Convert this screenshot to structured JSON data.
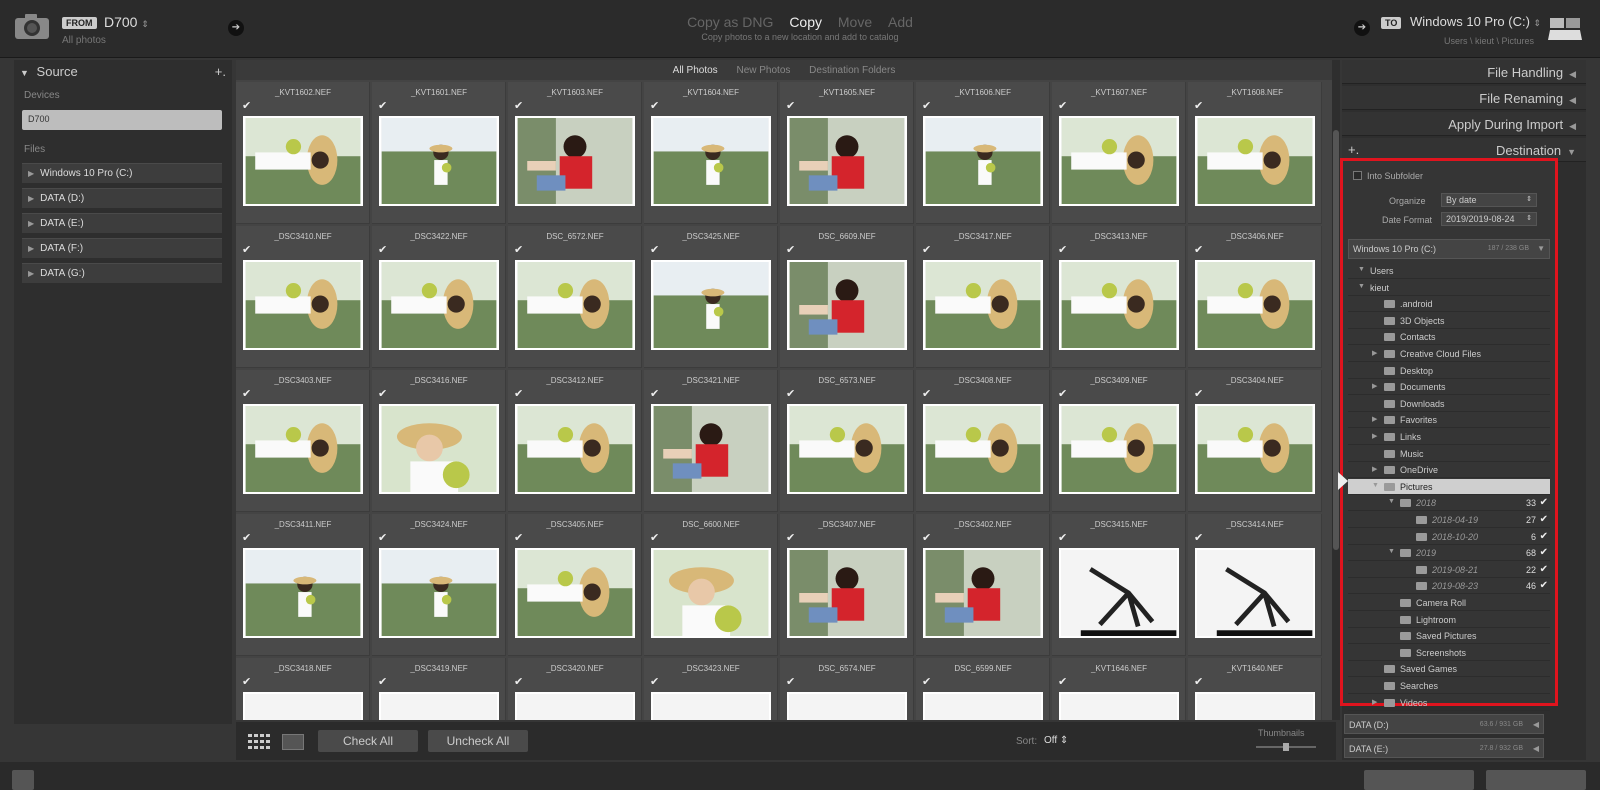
{
  "topbar": {
    "from_badge": "FROM",
    "source_name": "D700",
    "source_caret": "⇕",
    "source_sub": "All photos",
    "modes": [
      "Copy as DNG",
      "Copy",
      "Move",
      "Add"
    ],
    "active_mode_index": 1,
    "mode_sub": "Copy photos to a new location and add to catalog",
    "to_badge": "TO",
    "dest_name": "Windows 10 Pro (C:)",
    "dest_caret": "⇕",
    "dest_sub": "Users \\ kieut \\ Pictures",
    "arrow_glyph": "➔"
  },
  "left": {
    "title": "Source",
    "title_arrow": "▼",
    "add_glyph": "+.",
    "devices_label": "Devices",
    "device": "D700",
    "files_label": "Files",
    "drives": [
      "Windows 10 Pro (C:)",
      "DATA (D:)",
      "DATA (E:)",
      "DATA (F:)",
      "DATA (G:)"
    ],
    "drive_arrow": "▶"
  },
  "tabs": [
    "All Photos",
    "New Photos",
    "Destination Folders"
  ],
  "grid": {
    "check_glyph": "✔",
    "rows": [
      [
        "_KVT1602.NEF",
        "_KVT1601.NEF",
        "_KVT1603.NEF",
        "_KVT1604.NEF",
        "_KVT1605.NEF",
        "_KVT1606.NEF",
        "_KVT1607.NEF",
        "_KVT1608.NEF"
      ],
      [
        "_DSC3410.NEF",
        "_DSC3422.NEF",
        "DSC_6572.NEF",
        "_DSC3425.NEF",
        "DSC_6609.NEF",
        "_DSC3417.NEF",
        "_DSC3413.NEF",
        "_DSC3406.NEF"
      ],
      [
        "_DSC3403.NEF",
        "_DSC3416.NEF",
        "_DSC3412.NEF",
        "_DSC3421.NEF",
        "DSC_6573.NEF",
        "_DSC3408.NEF",
        "_DSC3409.NEF",
        "_DSC3404.NEF"
      ],
      [
        "_DSC3411.NEF",
        "_DSC3424.NEF",
        "_DSC3405.NEF",
        "DSC_6600.NEF",
        "_DSC3407.NEF",
        "_DSC3402.NEF",
        "_DSC3415.NEF",
        "_DSC3414.NEF"
      ],
      [
        "_DSC3418.NEF",
        "_DSC3419.NEF",
        "_DSC3420.NEF",
        "_DSC3423.NEF",
        "DSC_6574.NEF",
        "DSC_6599.NEF",
        "_KVT1646.NEF",
        "_KVT1640.NEF"
      ]
    ],
    "types": [
      [
        "portrait",
        "field",
        "red",
        "field",
        "red",
        "field",
        "portrait",
        "portrait"
      ],
      [
        "portrait",
        "portrait",
        "portrait",
        "field",
        "red",
        "portrait",
        "portrait",
        "portrait"
      ],
      [
        "portrait",
        "closeup",
        "portrait",
        "red",
        "portrait",
        "portrait",
        "portrait",
        "portrait"
      ],
      [
        "field",
        "field",
        "portrait",
        "closeup",
        "red",
        "red",
        "tripod",
        "tripod"
      ],
      [
        "blank",
        "blank",
        "blank",
        "blank",
        "blank",
        "blank",
        "blank",
        "blank"
      ]
    ]
  },
  "bottombar": {
    "check_all": "Check All",
    "uncheck_all": "Uncheck All",
    "sort_label": "Sort:",
    "sort_value": "Off ⇕",
    "thumbnails_label": "Thumbnails",
    "thumbnail_size": 0.5
  },
  "right": {
    "sections": [
      "File Handling",
      "File Renaming",
      "Apply During Import",
      "Destination"
    ],
    "collapsed_arrow": "◀",
    "expanded_arrow": "▼",
    "add_glyph": "+.",
    "into_subfolder": "Into Subfolder",
    "organize_label": "Organize",
    "organize_value": "By date",
    "date_format_label": "Date Format",
    "date_format_value": "2019/2019-08-24",
    "volume": "Windows 10 Pro (C:)",
    "volume_size": "187 / 238 GB",
    "select_caret": "⇕",
    "vol_arrow": "▼",
    "tree_collapse": "▼",
    "tree_expand": "▶",
    "tree_check": "✔",
    "tree": [
      {
        "label": "Users",
        "depth": 0,
        "expander": "collapse",
        "folder": false
      },
      {
        "label": "kieut",
        "depth": 0,
        "expander": "collapse",
        "folder": false
      },
      {
        "label": ".android",
        "depth": 1,
        "folder": true
      },
      {
        "label": "3D Objects",
        "depth": 1,
        "folder": true
      },
      {
        "label": "Contacts",
        "depth": 1,
        "folder": true
      },
      {
        "label": "Creative Cloud Files",
        "depth": 1,
        "expander": "expand",
        "folder": true
      },
      {
        "label": "Desktop",
        "depth": 1,
        "folder": true
      },
      {
        "label": "Documents",
        "depth": 1,
        "expander": "expand",
        "folder": true
      },
      {
        "label": "Downloads",
        "depth": 1,
        "folder": true
      },
      {
        "label": "Favorites",
        "depth": 1,
        "expander": "expand",
        "folder": true
      },
      {
        "label": "Links",
        "depth": 1,
        "expander": "expand",
        "folder": true
      },
      {
        "label": "Music",
        "depth": 1,
        "folder": true
      },
      {
        "label": "OneDrive",
        "depth": 1,
        "expander": "expand",
        "folder": true
      },
      {
        "label": "Pictures",
        "depth": 1,
        "expander": "collapse",
        "folder": true,
        "selected": true
      },
      {
        "label": "2018",
        "depth": 2,
        "expander": "collapse",
        "folder": true,
        "italic": true,
        "count": "33",
        "check": true
      },
      {
        "label": "2018-04-19",
        "depth": 3,
        "folder": true,
        "italic": true,
        "count": "27",
        "check": true
      },
      {
        "label": "2018-10-20",
        "depth": 3,
        "folder": true,
        "italic": true,
        "count": "6",
        "check": true
      },
      {
        "label": "2019",
        "depth": 2,
        "expander": "collapse",
        "folder": true,
        "italic": true,
        "count": "68",
        "check": true
      },
      {
        "label": "2019-08-21",
        "depth": 3,
        "folder": true,
        "italic": true,
        "count": "22",
        "check": true
      },
      {
        "label": "2019-08-23",
        "depth": 3,
        "folder": true,
        "italic": true,
        "count": "46",
        "check": true
      },
      {
        "label": "Camera Roll",
        "depth": 2,
        "folder": true
      },
      {
        "label": "Lightroom",
        "depth": 2,
        "folder": true
      },
      {
        "label": "Saved Pictures",
        "depth": 2,
        "folder": true
      },
      {
        "label": "Screenshots",
        "depth": 2,
        "folder": true
      },
      {
        "label": "Saved Games",
        "depth": 1,
        "folder": true
      },
      {
        "label": "Searches",
        "depth": 1,
        "folder": true
      },
      {
        "label": "Videos",
        "depth": 1,
        "expander": "expand",
        "folder": true
      }
    ],
    "other_drives": [
      {
        "label": "DATA (D:)",
        "size": "63.6 / 931 GB"
      },
      {
        "label": "DATA (E:)",
        "size": "27.8 / 932 GB"
      }
    ]
  },
  "colors": {
    "highlight": "#e0141e",
    "photo_red_shirt": "#d4242c",
    "field_green": "#6f8a5a",
    "hat": "#d8b878"
  }
}
